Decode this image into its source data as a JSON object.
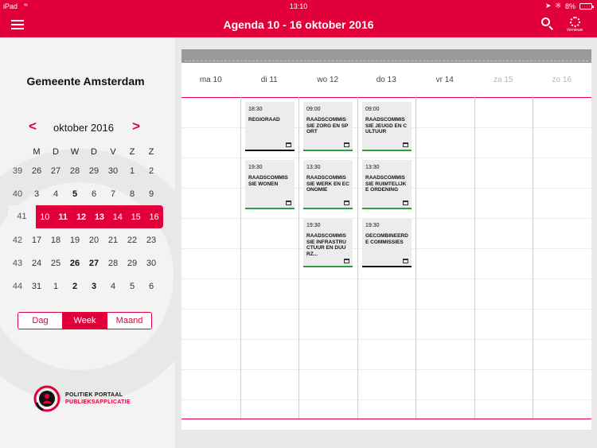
{
  "status_bar": {
    "carrier": "iPad",
    "time": "13:10",
    "battery": "8%",
    "battery_level": 0.08
  },
  "header": {
    "title": "Agenda 10 - 16 oktober 2016",
    "refresh_label": "Vernieuw"
  },
  "sidebar": {
    "municipality": "Gemeente Amsterdam",
    "month_label": "oktober 2016",
    "prev": "<",
    "next": ">",
    "weekday_headers": [
      "",
      "M",
      "D",
      "W",
      "D",
      "V",
      "Z",
      "Z"
    ],
    "weeks": [
      [
        "39",
        "26",
        "27",
        "28",
        "29",
        "30",
        "1",
        "2"
      ],
      [
        "40",
        "3",
        "4",
        "5",
        "6",
        "7",
        "8",
        "9"
      ],
      [
        "41",
        "10",
        "11",
        "12",
        "13",
        "14",
        "15",
        "16"
      ],
      [
        "42",
        "17",
        "18",
        "19",
        "20",
        "21",
        "22",
        "23"
      ],
      [
        "43",
        "24",
        "25",
        "26",
        "27",
        "28",
        "29",
        "30"
      ],
      [
        "44",
        "31",
        "1",
        "2",
        "3",
        "4",
        "5",
        "6"
      ]
    ],
    "view_options": [
      "Dag",
      "Week",
      "Maand"
    ],
    "active_view": "Week",
    "logo_line1": "POLITIEK PORTAAL",
    "logo_line2": "PUBLIEKSAPPLICATIE"
  },
  "week": {
    "days": [
      "ma  10",
      "di  11",
      "wo  12",
      "do  13",
      "vr  14",
      "za  15",
      "zo  16"
    ],
    "events": [
      {
        "day": 1,
        "slot": 0,
        "time": "18:30",
        "name": "REGIORAAD",
        "color": "#111111"
      },
      {
        "day": 1,
        "slot": 1,
        "time": "19:30",
        "name": "RAADSCOMMISSIE WONEN",
        "color": "#2e9e3a"
      },
      {
        "day": 2,
        "slot": 0,
        "time": "09:00",
        "name": "RAADSCOMMISSIE ZORG EN SPORT",
        "color": "#2e9e3a"
      },
      {
        "day": 2,
        "slot": 1,
        "time": "13:30",
        "name": "RAADSCOMMISSIE WERK EN ECONOMIE",
        "color": "#2e9e3a"
      },
      {
        "day": 2,
        "slot": 2,
        "time": "19:30",
        "name": "RAADSCOMMISSIE INFRASTRUCTUUR EN DUURZ...",
        "color": "#2e9e3a"
      },
      {
        "day": 3,
        "slot": 0,
        "time": "09:00",
        "name": "RAADSCOMMISSIE JEUGD EN CULTUUR",
        "color": "#2e9e3a"
      },
      {
        "day": 3,
        "slot": 1,
        "time": "13:30",
        "name": "RAADSCOMMISSIE RUIMTELIJKE ORDENING",
        "color": "#2e9e3a"
      },
      {
        "day": 3,
        "slot": 2,
        "time": "19:30",
        "name": "GECOMBINEERDE COMMISSIES",
        "color": "#111111"
      }
    ]
  },
  "colors": {
    "accent": "#e2003b",
    "event_bg": "#ececec"
  }
}
